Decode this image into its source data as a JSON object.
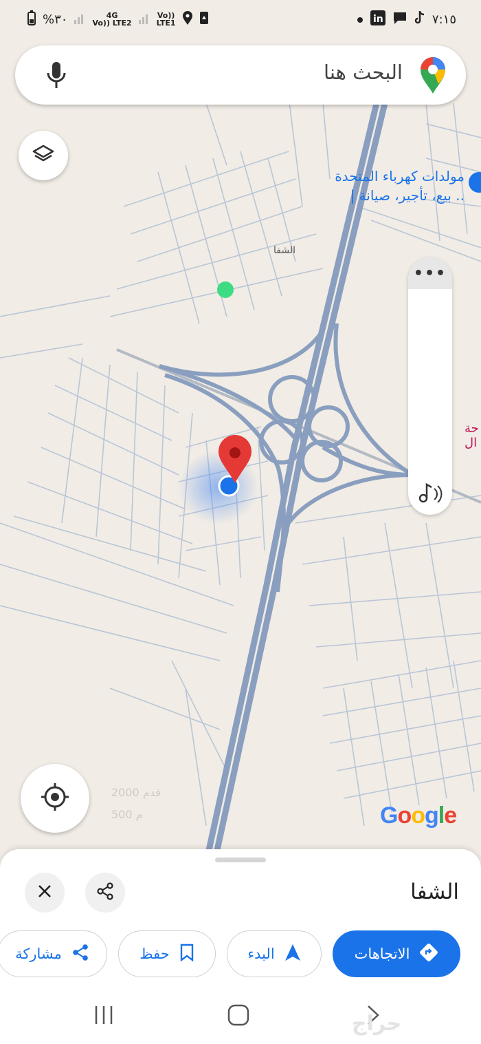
{
  "status_bar": {
    "time": "٧:١٥",
    "battery": "%٣٠",
    "sim1": {
      "top": "4G",
      "bottom": "Vo)) LTE2"
    },
    "sim2": {
      "top": "Vo))",
      "bottom": "LTE1"
    },
    "app_icons": [
      "linkedin-icon",
      "chat-icon",
      "tiktok-icon",
      "dot-icon"
    ],
    "status_icons": [
      "location-icon",
      "save-icon",
      "signal-icon"
    ]
  },
  "search": {
    "placeholder": "البحث هنا",
    "icons": [
      "mic-icon",
      "google-maps-pin-icon"
    ]
  },
  "map": {
    "poi_name": "مولدات كهرباء المتحدة",
    "poi_subtitle": "| بيع، تأجير، صيانة ..",
    "area_label": "الشفا",
    "edge_label": "حة ال",
    "scale_top": "2000 قدم",
    "scale_bottom": "500 م",
    "logo": "Google"
  },
  "colors": {
    "accent": "#1a73e8",
    "map_bg": "#f1ece5",
    "highway": "#8a9fbf",
    "street": "#b6c4d6",
    "pin": "#e53935",
    "green_dot": "#3ddc84"
  },
  "sheet": {
    "title": "الشفا",
    "buttons": {
      "directions": "الاتجاهات",
      "start": "البدء",
      "save": "حفظ",
      "share": "مشاركة"
    }
  },
  "nav": {
    "icons": [
      "recents-icon",
      "home-icon",
      "back-icon"
    ]
  },
  "watermark": "حراج"
}
